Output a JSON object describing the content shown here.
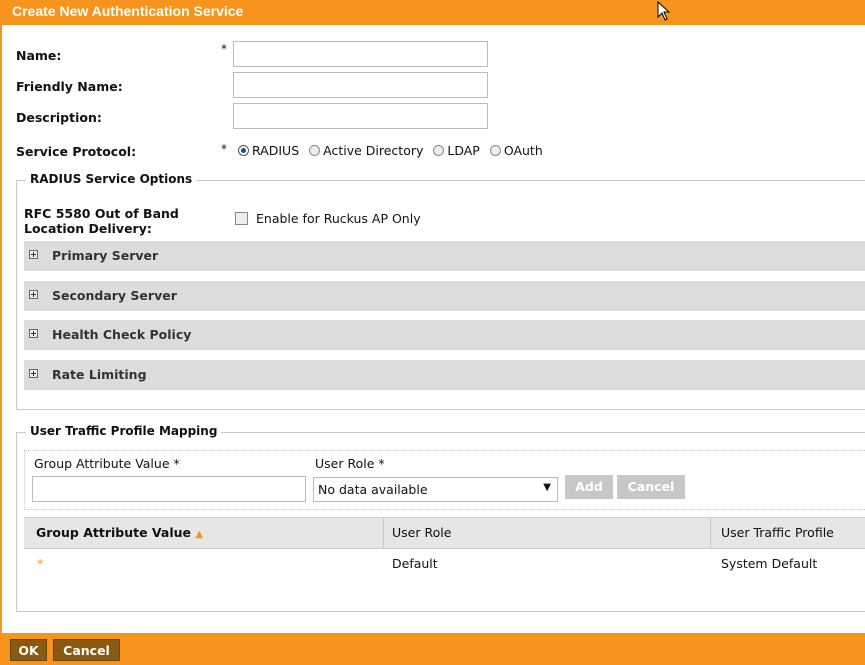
{
  "dialog": {
    "title": "Create New Authentication Service"
  },
  "form": {
    "name_label": "Name:",
    "friendly_name_label": "Friendly Name:",
    "description_label": "Description:",
    "service_protocol_label": "Service Protocol:",
    "required_mark": "*",
    "protocols": [
      "RADIUS",
      "Active Directory",
      "LDAP",
      "OAuth"
    ],
    "selected_protocol": "RADIUS",
    "name_value": "",
    "friendly_name_value": "",
    "description_value": ""
  },
  "radius_options": {
    "legend": "RADIUS Service Options",
    "rfc_label_line1": "RFC 5580 Out of Band",
    "rfc_label_line2": "Location Delivery:",
    "checkbox_label": "Enable for Ruckus AP Only",
    "checkbox_checked": false,
    "sections": [
      "Primary Server",
      "Secondary Server",
      "Health Check Policy",
      "Rate Limiting"
    ]
  },
  "mapping": {
    "legend": "User Traffic Profile Mapping",
    "group_attr_label": "Group Attribute Value *",
    "user_role_label": "User Role *",
    "user_role_selected": "No data available",
    "add_button": "Add",
    "cancel_button": "Cancel",
    "table": {
      "headers": [
        "Group Attribute Value",
        "User Role",
        "User Traffic Profile"
      ],
      "sort_indicator": "▲",
      "rows": [
        {
          "group_attr": "*",
          "user_role": "Default",
          "profile": "System Default"
        }
      ]
    }
  },
  "footer": {
    "ok": "OK",
    "cancel": "Cancel"
  },
  "colors": {
    "accent": "#f7941d",
    "footer_button": "#8a5a12",
    "section_bg": "#dcdcdc"
  }
}
